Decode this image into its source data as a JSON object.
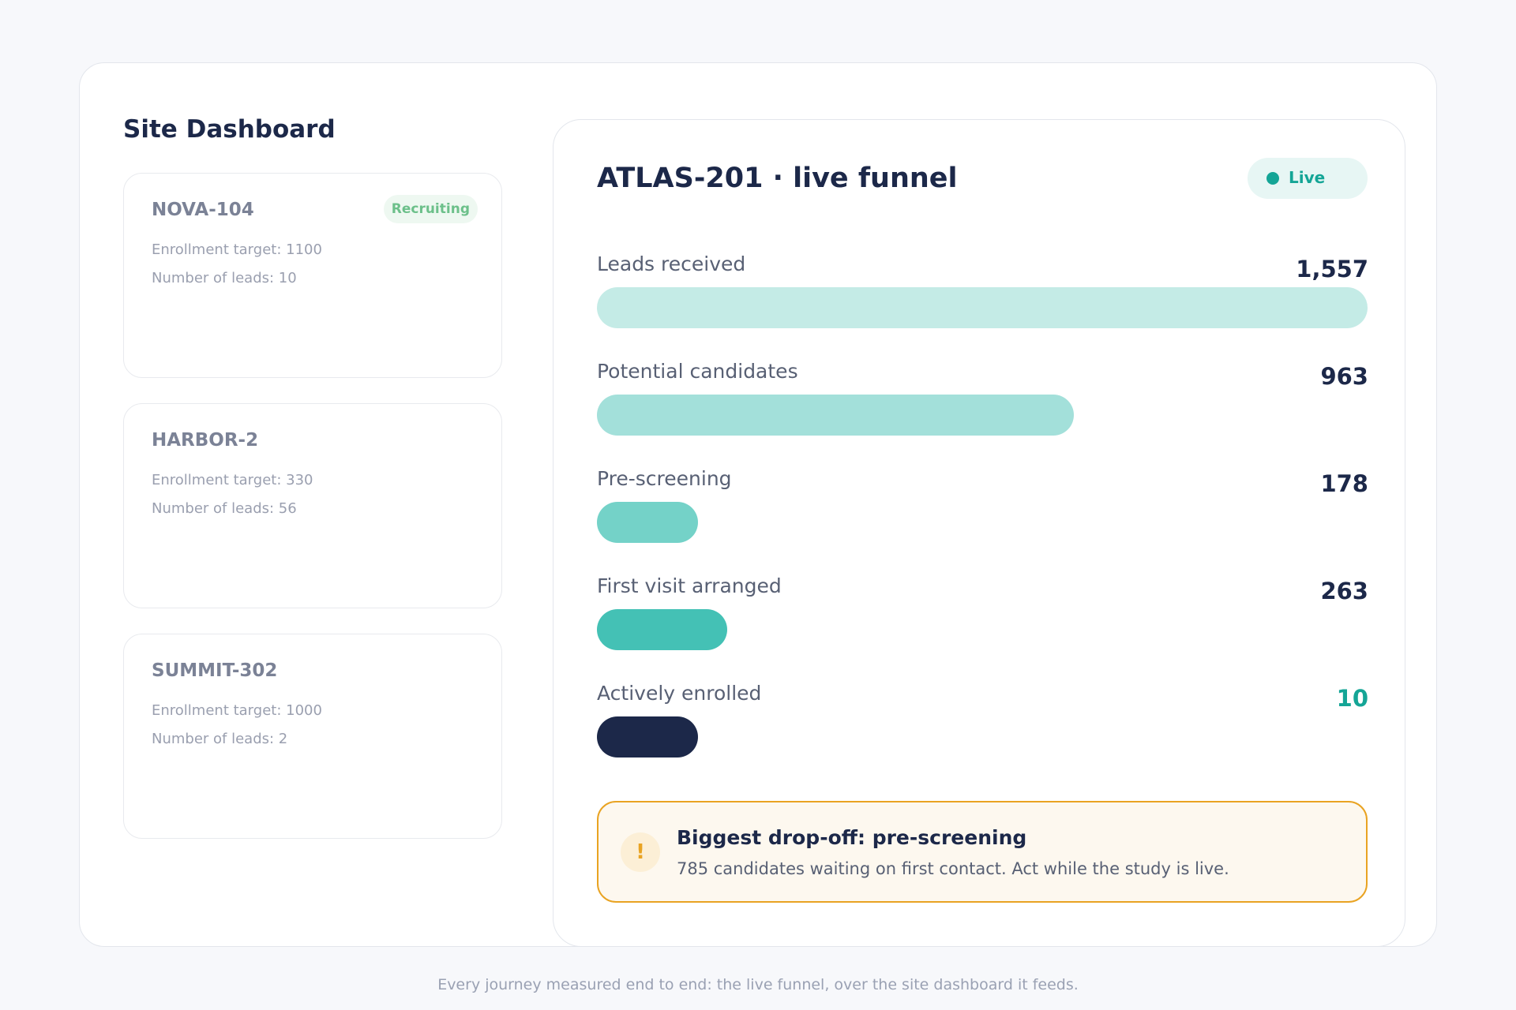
{
  "dashboard": {
    "title": "Site Dashboard",
    "sites": [
      {
        "name": "NOVA-104",
        "badge": "Recruiting",
        "enrollment": "Enrollment target: 1100",
        "leads": "Number of leads: 10"
      },
      {
        "name": "HARBOR-2",
        "enrollment": "Enrollment target: 330",
        "leads": "Number of leads: 56"
      },
      {
        "name": "SUMMIT-302",
        "enrollment": "Enrollment target: 1000",
        "leads": "Number of leads: 2"
      }
    ]
  },
  "funnel": {
    "title": "ATLAS-201 · live funnel",
    "status": "Live",
    "status_color": "#14a596",
    "stages": [
      {
        "label": "Leads received",
        "value": "1,557",
        "count": 1557,
        "color": "#c4ebe6"
      },
      {
        "label": "Potential candidates",
        "value": "963",
        "count": 963,
        "color": "#a3e0da"
      },
      {
        "label": "Pre-screening",
        "value": "178",
        "count": 178,
        "color": "#74d2c8"
      },
      {
        "label": "First visit arranged",
        "value": "263",
        "count": 263,
        "color": "#44c1b5"
      },
      {
        "label": "Actively enrolled",
        "value": "10",
        "count": 10,
        "color": "#1c2849",
        "value_color": "#14a596"
      }
    ],
    "alert": {
      "icon": "!",
      "icon_name": "warning-icon",
      "title": "Biggest drop-off: pre-screening",
      "body": "785 candidates waiting on first contact. Act while the study is live.",
      "accent": "#e9a322"
    }
  },
  "caption": "Every journey measured end to end: the live funnel, over the site dashboard it feeds."
}
